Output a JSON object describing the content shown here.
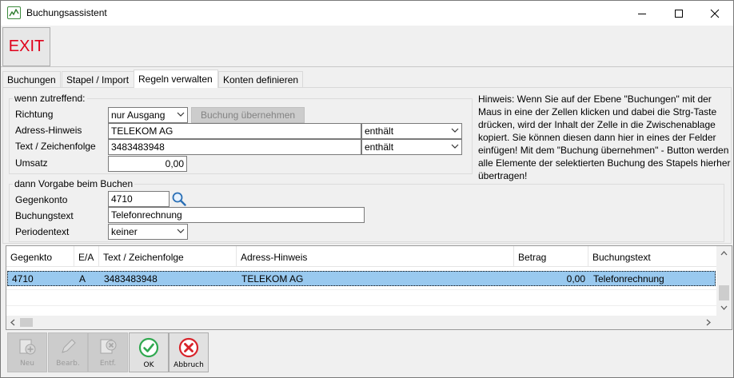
{
  "window": {
    "title": "Buchungsassistent"
  },
  "toolbar": {
    "exit_label": "EXIT"
  },
  "tabs": [
    {
      "label": "Buchungen"
    },
    {
      "label": "Stapel / Import"
    },
    {
      "label": "Regeln verwalten"
    },
    {
      "label": "Konten definieren"
    }
  ],
  "condition": {
    "legend": "wenn zutreffend:",
    "richtung_label": "Richtung",
    "richtung_value": "nur Ausgang",
    "uebernehmen_label": "Buchung übernehmen",
    "adress_label": "Adress-Hinweis",
    "adress_value": "TELEKOM AG",
    "adress_op": "enthält",
    "text_label": "Text / Zeichenfolge",
    "text_value": "3483483948",
    "text_op": "enthält",
    "umsatz_label": "Umsatz",
    "umsatz_value": "0,00"
  },
  "defaults": {
    "legend": "dann Vorgabe beim Buchen",
    "gegenkonto_label": "Gegenkonto",
    "gegenkonto_value": "4710",
    "buchungstext_label": "Buchungstext",
    "buchungstext_value": "Telefonrechnung",
    "periodentext_label": "Periodentext",
    "periodentext_value": "keiner"
  },
  "hint": "Hinweis: Wenn Sie auf der Ebene \"Buchungen\" mit der Maus in eine der Zellen klicken und dabei die Strg-Taste drücken, wird der Inhalt der Zelle in die Zwischenablage kopiert. Sie können diesen dann hier in eines der Felder einfügen! Mit dem \"Buchung übernehmen\" - Button werden alle Elemente der selektierten Buchung des Stapels hierher übertragen!",
  "grid": {
    "columns": [
      "Gegenkto",
      "E/A",
      "Text / Zeichenfolge",
      "Adress-Hinweis",
      "Betrag",
      "Buchungstext"
    ],
    "rows": [
      {
        "gegenkto": "4710",
        "ea": "A",
        "text": "3483483948",
        "adresse": "TELEKOM AG",
        "betrag": "0,00",
        "buchungstext": "Telefonrechnung"
      }
    ]
  },
  "actions": {
    "neu": "Neu",
    "bearb": "Bearb.",
    "entf": "Entf.",
    "ok": "OK",
    "abbruch": "Abbruch"
  },
  "colors": {
    "exit_text": "#e0001a",
    "selection": "#99c9ef",
    "ok_green": "#2fa84f",
    "cancel_red": "#d8232a"
  }
}
